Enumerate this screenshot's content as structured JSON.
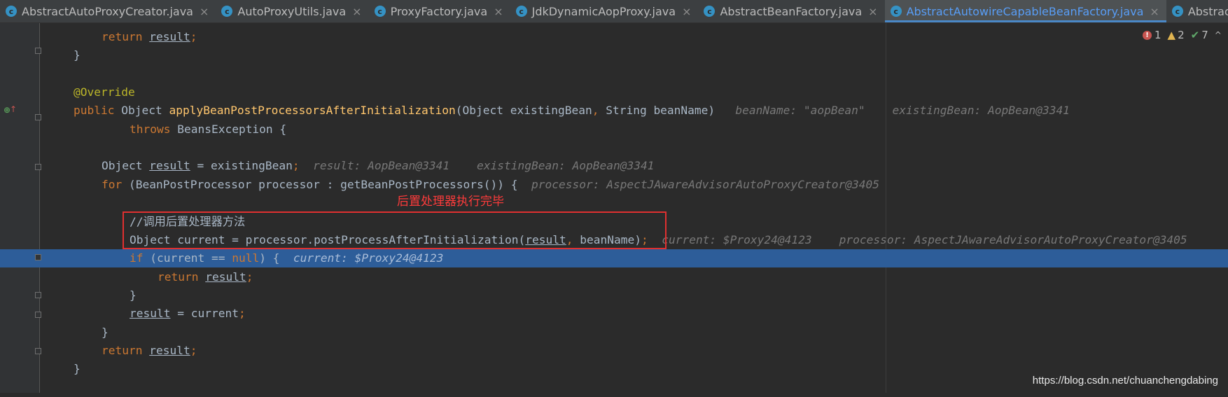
{
  "tabs": [
    {
      "label": "AbstractAutoProxyCreator.java",
      "active": false,
      "icon": "class-icon",
      "close": "×"
    },
    {
      "label": "AutoProxyUtils.java",
      "active": false,
      "icon": "class-icon",
      "close": "×"
    },
    {
      "label": "ProxyFactory.java",
      "active": false,
      "icon": "class-icon",
      "close": "×"
    },
    {
      "label": "JdkDynamicAopProxy.java",
      "active": false,
      "icon": "class-icon",
      "close": "×"
    },
    {
      "label": "AbstractBeanFactory.java",
      "active": false,
      "icon": "class-icon",
      "close": "×"
    },
    {
      "label": "AbstractAutowireCapableBeanFactory.java",
      "active": true,
      "icon": "class-icon",
      "close": "×"
    },
    {
      "label": "AbstractNestableProperty",
      "active": false,
      "icon": "class-icon",
      "close": ""
    }
  ],
  "inspection": {
    "errors": "1",
    "warnings": "2",
    "weak_warnings": "7"
  },
  "code_lines": [
    {
      "indent": 1,
      "tokens": [
        [
          "kw",
          "return "
        ],
        [
          "var",
          "result"
        ],
        [
          "kw",
          ";"
        ]
      ]
    },
    {
      "indent": 0,
      "tokens": [
        [
          "p",
          "}"
        ]
      ]
    },
    {
      "indent": 0,
      "tokens": []
    },
    {
      "indent": 0,
      "tokens": [
        [
          "ann",
          "@Override"
        ]
      ]
    },
    {
      "indent": 0,
      "tokens": [
        [
          "kw",
          "public "
        ],
        [
          "p",
          "Object "
        ],
        [
          "fn",
          "applyBeanPostProcessorsAfterInitialization"
        ],
        [
          "p",
          "(Object existingBean"
        ],
        [
          "kw",
          ", "
        ],
        [
          "p",
          "String beanName)"
        ],
        [
          "hint",
          "   beanName: \"aopBean\"    existingBean: AopBean@3341"
        ]
      ]
    },
    {
      "indent": 2,
      "tokens": [
        [
          "kw",
          "throws "
        ],
        [
          "p",
          "BeansException {"
        ]
      ]
    },
    {
      "indent": 0,
      "tokens": []
    },
    {
      "indent": 1,
      "tokens": [
        [
          "p",
          "Object "
        ],
        [
          "var",
          "result"
        ],
        [
          "p",
          " = existingBean"
        ],
        [
          "kw",
          ";"
        ],
        [
          "hint",
          "  result: AopBean@3341    existingBean: AopBean@3341"
        ]
      ]
    },
    {
      "indent": 1,
      "tokens": [
        [
          "kw",
          "for "
        ],
        [
          "p",
          "(BeanPostProcessor processor : getBeanPostProcessors()) {"
        ],
        [
          "hint",
          "  processor: AspectJAwareAdvisorAutoProxyCreator@3405"
        ]
      ]
    },
    {
      "indent": 0,
      "tokens": []
    },
    {
      "indent": 2,
      "tokens": [
        [
          "p",
          "//调用后置处理器方法"
        ]
      ]
    },
    {
      "indent": 2,
      "tokens": [
        [
          "p",
          "Object current = processor.postProcessAfterInitialization("
        ],
        [
          "var",
          "result"
        ],
        [
          "kw",
          ", "
        ],
        [
          "p",
          "beanName)"
        ],
        [
          "kw",
          ";"
        ],
        [
          "hint",
          "  current: $Proxy24@4123    processor: AspectJAwareAdvisorAutoProxyCreator@3405"
        ]
      ]
    },
    {
      "indent": 2,
      "exec": true,
      "tokens": [
        [
          "kw",
          "if "
        ],
        [
          "p",
          "(current == "
        ],
        [
          "kw",
          "null"
        ],
        [
          "p",
          ") {"
        ],
        [
          "hint-exec",
          "  current: $Proxy24@4123"
        ]
      ]
    },
    {
      "indent": 3,
      "tokens": [
        [
          "kw",
          "return "
        ],
        [
          "var",
          "result"
        ],
        [
          "kw",
          ";"
        ]
      ]
    },
    {
      "indent": 2,
      "tokens": [
        [
          "p",
          "}"
        ]
      ]
    },
    {
      "indent": 2,
      "tokens": [
        [
          "var",
          "result"
        ],
        [
          "p",
          " = current"
        ],
        [
          "kw",
          ";"
        ]
      ]
    },
    {
      "indent": 1,
      "tokens": [
        [
          "p",
          "}"
        ]
      ]
    },
    {
      "indent": 1,
      "tokens": [
        [
          "kw",
          "return "
        ],
        [
          "var",
          "result"
        ],
        [
          "kw",
          ";"
        ]
      ]
    },
    {
      "indent": 0,
      "tokens": [
        [
          "p",
          "}"
        ]
      ]
    },
    {
      "indent": 0,
      "tokens": []
    }
  ],
  "annotation_note": "后置处理器执行完毕",
  "watermark": "https://blog.csdn.net/chuanchengdabing",
  "colors": {
    "background": "#2b2b2b",
    "execution_line": "#2d5d99",
    "keyword": "#cc7832",
    "annotation": "#bbb529",
    "method": "#ffc66d",
    "highlight_box": "#e03030"
  }
}
